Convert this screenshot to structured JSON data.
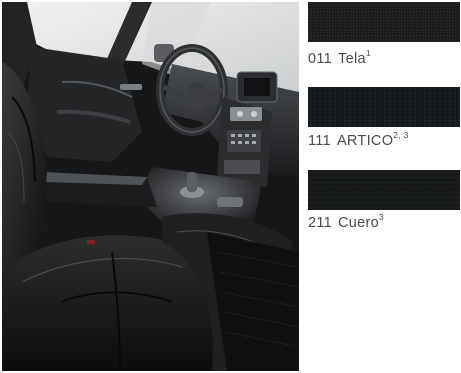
{
  "photo": {
    "icon": "car-interior-photo"
  },
  "upholstery": [
    {
      "code": "011",
      "name": "Tela",
      "sup": "1",
      "color": "#1a1b1c"
    },
    {
      "code": "111",
      "name": "ARTICO",
      "sup": "2, 3",
      "color": "#15191c"
    },
    {
      "code": "211",
      "name": "Cuero",
      "sup": "3",
      "color": "#161819"
    }
  ]
}
